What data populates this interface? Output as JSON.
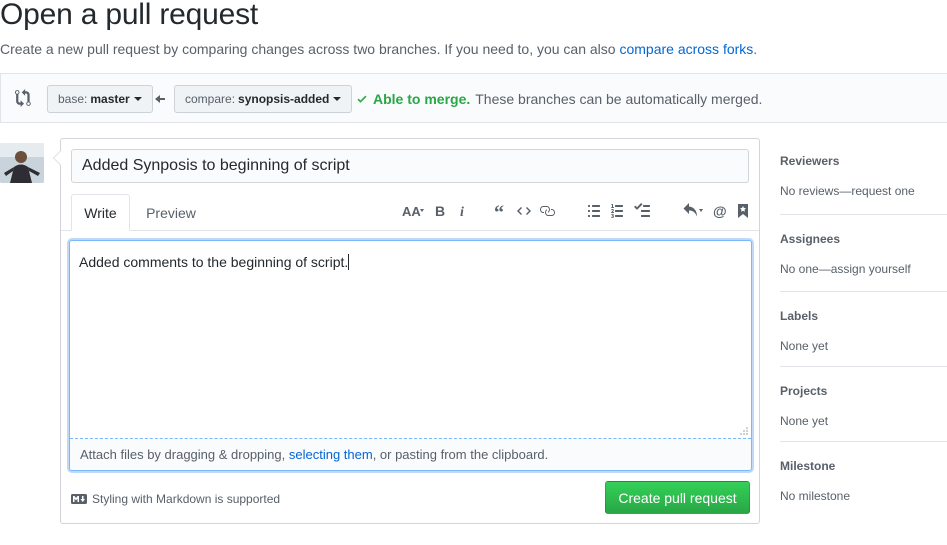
{
  "header": {
    "title": "Open a pull request",
    "subtitle_prefix": "Create a new pull request by comparing changes across two branches. If you need to, you can also ",
    "subtitle_link": "compare across forks",
    "subtitle_suffix": "."
  },
  "range": {
    "base_prefix": "base:",
    "base_value": "master",
    "compare_prefix": "compare:",
    "compare_value": "synopsis-added",
    "merge_status": "Able to merge.",
    "merge_message": "These branches can be automatically merged."
  },
  "form": {
    "title_value": "Added Synposis to beginning of script",
    "tabs": {
      "write": "Write",
      "preview": "Preview"
    },
    "toolbar_icons": [
      "text-size-icon",
      "bold-icon",
      "italic-icon",
      "quote-icon",
      "code-icon",
      "link-icon",
      "unordered-list-icon",
      "ordered-list-icon",
      "task-list-icon",
      "reply-icon",
      "mention-icon",
      "bookmark-icon"
    ],
    "body_value": "Added comments to the beginning of script.",
    "attach_prefix": "Attach files by dragging & dropping, ",
    "attach_link": "selecting them",
    "attach_suffix": ", or pasting from the clipboard.",
    "markdown_note": "Styling with Markdown is supported",
    "submit_label": "Create pull request"
  },
  "sidebar": {
    "sections": [
      {
        "heading": "Reviewers",
        "value": "No reviews—request one"
      },
      {
        "heading": "Assignees",
        "value": "No one—assign yourself"
      },
      {
        "heading": "Labels",
        "value": "None yet"
      },
      {
        "heading": "Projects",
        "value": "None yet"
      },
      {
        "heading": "Milestone",
        "value": "No milestone"
      }
    ]
  },
  "colors": {
    "accent_link": "#0366d6",
    "success": "#28a745",
    "focus_border": "#79b8ff"
  }
}
